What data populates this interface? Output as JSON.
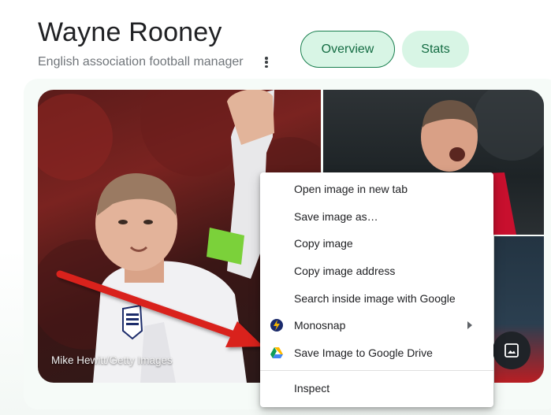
{
  "knowledge_panel": {
    "title": "Wayne Rooney",
    "subtitle": "English association football manager",
    "chips": [
      {
        "label": "Overview",
        "selected": true
      },
      {
        "label": "Stats",
        "selected": false
      }
    ],
    "photo_credit": "Mike Hewitt/Getty Images"
  },
  "context_menu": {
    "items": [
      {
        "label": "Open image in new tab",
        "icon": ""
      },
      {
        "label": "Save image as…",
        "icon": ""
      },
      {
        "label": "Copy image",
        "icon": ""
      },
      {
        "label": "Copy image address",
        "icon": ""
      },
      {
        "label": "Search inside image with Google",
        "icon": ""
      },
      {
        "label": "Monosnap",
        "icon": "monosnap-icon",
        "has_submenu": true
      },
      {
        "label": "Save Image to Google Drive",
        "icon": "google-drive-icon"
      }
    ],
    "after_separator": [
      {
        "label": "Inspect",
        "icon": ""
      }
    ]
  },
  "colors": {
    "chip_bg": "#d8f5e5",
    "chip_text": "#146c43",
    "chip_border": "#1a7f4f",
    "annotation_arrow": "#d9201f"
  }
}
